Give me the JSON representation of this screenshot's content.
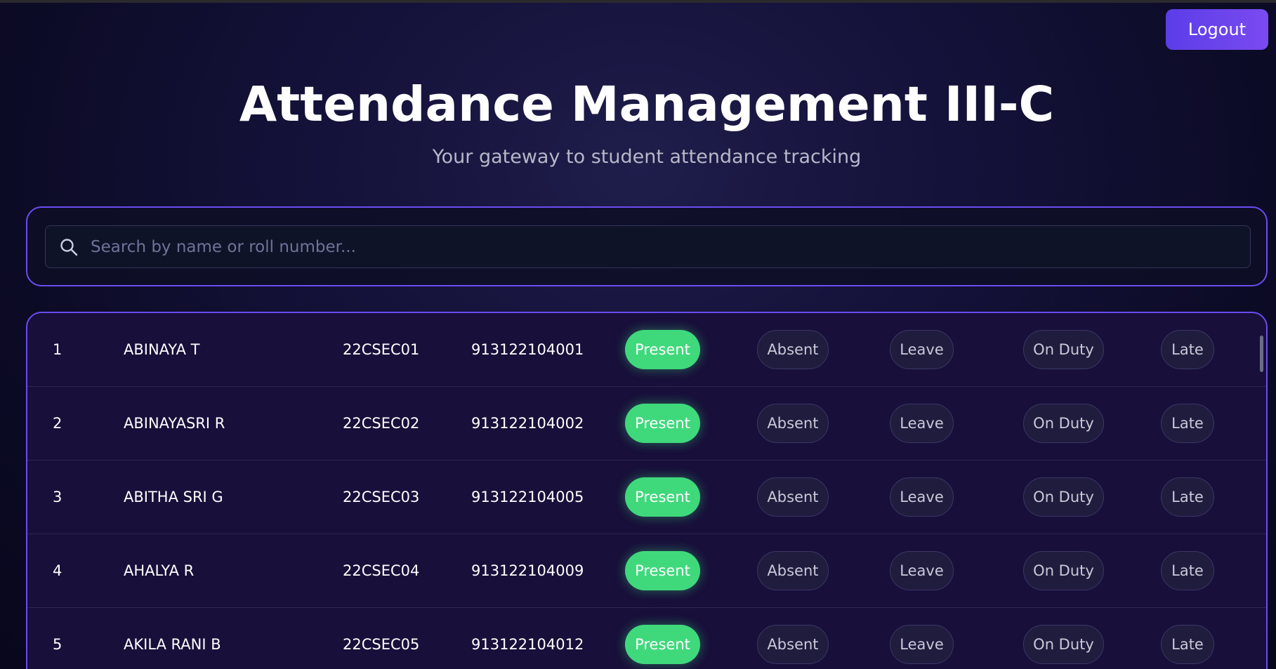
{
  "header": {
    "logout_label": "Logout",
    "title": "Attendance Management III-C",
    "subtitle": "Your gateway to student attendance tracking"
  },
  "search": {
    "placeholder": "Search by name or roll number...",
    "icon": "search-icon"
  },
  "status_options": [
    "Present",
    "Absent",
    "Leave",
    "On Duty",
    "Late"
  ],
  "colors": {
    "accent": "#6a4cf0",
    "present_active": "#3fd97c",
    "logout": "#6344ec"
  },
  "students": [
    {
      "num": "1",
      "name": "ABINAYA T",
      "reg": "22CSEC01",
      "roll": "913122104001",
      "status": "Present"
    },
    {
      "num": "2",
      "name": "ABINAYASRI R",
      "reg": "22CSEC02",
      "roll": "913122104002",
      "status": "Present"
    },
    {
      "num": "3",
      "name": "ABITHA SRI G",
      "reg": "22CSEC03",
      "roll": "913122104005",
      "status": "Present"
    },
    {
      "num": "4",
      "name": "AHALYA R",
      "reg": "22CSEC04",
      "roll": "913122104009",
      "status": "Present"
    },
    {
      "num": "5",
      "name": "AKILA RANI B",
      "reg": "22CSEC05",
      "roll": "913122104012",
      "status": "Present"
    }
  ]
}
